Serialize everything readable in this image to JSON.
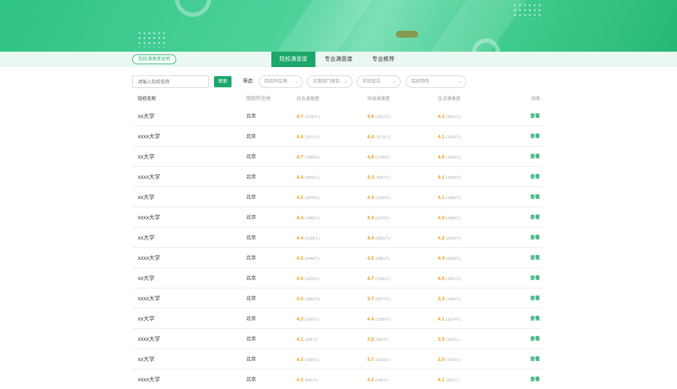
{
  "tabbar": {
    "desc_button": "院校满意度说明",
    "tabs": [
      {
        "label": "院校满意度",
        "active": true
      },
      {
        "label": "专业满意度",
        "active": false
      },
      {
        "label": "专业推荐",
        "active": false
      }
    ]
  },
  "filters": {
    "search_placeholder": "请输入院校名称",
    "search_button": "搜索",
    "filter_label": "筛选:",
    "selects": [
      "院校所在地",
      "主管部门类别",
      "学历层次",
      "院校特性"
    ]
  },
  "table": {
    "headers": [
      "院校名称",
      "院校所在地",
      "综合满意度",
      "环境满意度",
      "生活满意度",
      "详情"
    ],
    "rows": [
      {
        "name": "xx大学",
        "loc": "北京",
        "s1": "4.7",
        "n1": "(1706人)",
        "s2": "4.6",
        "n2": "(1527人)",
        "s3": "4.3",
        "n3": "(1661人)",
        "detail": "查看"
      },
      {
        "name": "xxxx大学",
        "loc": "北京",
        "s1": "4.6",
        "n1": "(1071人)",
        "s2": "4.4",
        "n2": "(1174人)",
        "s3": "4.1",
        "n3": "(1003人)",
        "detail": "查看"
      },
      {
        "name": "xx大学",
        "loc": "北京",
        "s1": "4.7",
        "n1": "(1589人)",
        "s2": "4.8",
        "n2": "(1768人)",
        "s3": "4.8",
        "n3": "(1656人)",
        "detail": "查看"
      },
      {
        "name": "xxxx大学",
        "loc": "北京",
        "s1": "4.4",
        "n1": "(3456人)",
        "s2": "4.3",
        "n2": "(3047人)",
        "s3": "4.1",
        "n3": "(3990人)",
        "detail": "查看"
      },
      {
        "name": "xx大学",
        "loc": "北京",
        "s1": "4.3",
        "n1": "(1078人)",
        "s2": "4.4",
        "n2": "(1220人)",
        "s3": "4.1",
        "n3": "(1046人)",
        "detail": "查看"
      },
      {
        "name": "xxxx大学",
        "loc": "北京",
        "s1": "4.4",
        "n1": "(1485人)",
        "s2": "4.4",
        "n2": "(1679人)",
        "s3": "4.0",
        "n3": "(1485人)",
        "detail": "查看"
      },
      {
        "name": "xx大学",
        "loc": "北京",
        "s1": "4.4",
        "n1": "(2125人)",
        "s2": "4.4",
        "n2": "(2081人)",
        "s3": "4.2",
        "n3": "(2659人)",
        "detail": "查看"
      },
      {
        "name": "xxxx大学",
        "loc": "北京",
        "s1": "4.5",
        "n1": "(2448人)",
        "s2": "4.5",
        "n2": "(2581人)",
        "s3": "4.4",
        "n3": "(2356人)",
        "detail": "查看"
      },
      {
        "name": "xx大学",
        "loc": "北京",
        "s1": "4.5",
        "n1": "(1129人)",
        "s2": "4.7",
        "n2": "(1266人)",
        "s3": "4.5",
        "n3": "(1061人)",
        "detail": "查看"
      },
      {
        "name": "xxxx大学",
        "loc": "北京",
        "s1": "4.0",
        "n1": "(1850人)",
        "s2": "3.7",
        "n2": "(2077人)",
        "s3": "3.3",
        "n3": "(1849人)",
        "detail": "查看"
      },
      {
        "name": "xx大学",
        "loc": "北京",
        "s1": "4.3",
        "n1": "(1160人)",
        "s2": "4.4",
        "n2": "(1338人)",
        "s3": "4.1",
        "n3": "(1124人)",
        "detail": "查看"
      },
      {
        "name": "xxxx大学",
        "loc": "北京",
        "s1": "4.1",
        "n1": "(334人)",
        "s2": "3.8",
        "n2": "(565人)",
        "s3": "3.5",
        "n3": "(323人)",
        "detail": "查看"
      },
      {
        "name": "xx大学",
        "loc": "北京",
        "s1": "4.3",
        "n1": "(1496人)",
        "s2": "3.7",
        "n2": "(2018人)",
        "s3": "3.5",
        "n3": "(1875人)",
        "detail": "查看"
      },
      {
        "name": "xxxx大学",
        "loc": "北京",
        "s1": "4.3",
        "n1": "(649人)",
        "s2": "4.2",
        "n2": "(748人)",
        "s3": "4.1",
        "n3": "(631人)",
        "detail": "查看"
      }
    ]
  },
  "colors": {
    "accent": "#1ca66a",
    "score": "#e8a426"
  },
  "icons": {
    "select_arrow": "chevron-down-icon"
  }
}
